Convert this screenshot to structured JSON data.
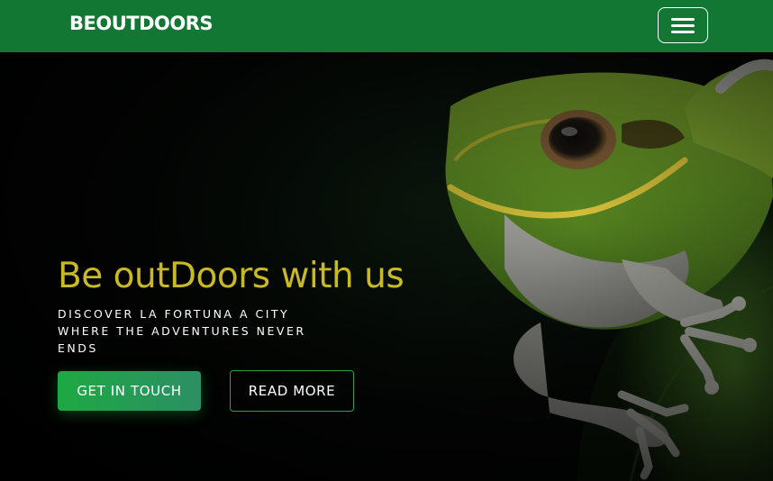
{
  "navbar": {
    "brand": "BEOUTDOORS",
    "menu_icon": "hamburger-menu-icon",
    "background_color": "#137734"
  },
  "hero": {
    "title": "Be outDoors with us",
    "subtitle": "DISCOVER LA FORTUNA A CITY WHERE THE ADVENTURES NEVER ENDS",
    "title_color": "#c9b925",
    "image_subject": "tree frog",
    "buttons": {
      "get_in_touch": "GET IN TOUCH",
      "read_more": "READ MORE"
    },
    "accent_color": "#1ea843"
  }
}
